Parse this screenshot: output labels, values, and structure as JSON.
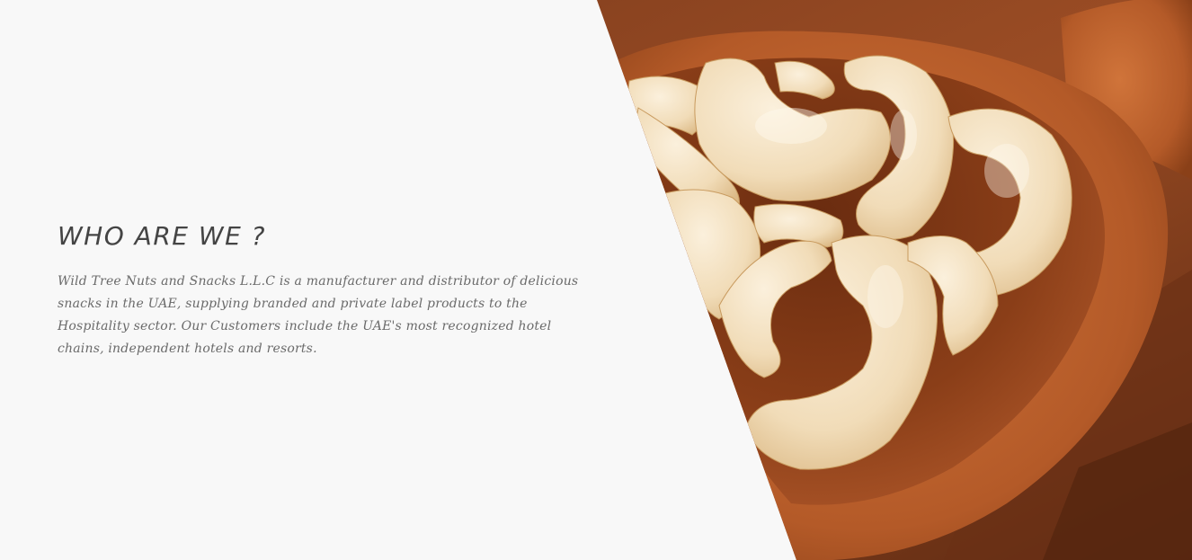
{
  "about": {
    "heading": "WHO ARE WE ?",
    "description": "Wild Tree Nuts and Snacks L.L.C is a manufacturer and distributor of delicious snacks in the UAE, supplying branded and private label products to the Hospitality sector. Our Customers include the UAE's most recognized hotel chains, independent hotels and resorts."
  },
  "colors": {
    "background": "#f8f8f8",
    "heading_text": "#444444",
    "body_text": "#6a6a6a",
    "wood": "#b45a28",
    "cashew": "#f1dcb8"
  },
  "image": {
    "subject": "cashews-in-wooden-spoon"
  }
}
